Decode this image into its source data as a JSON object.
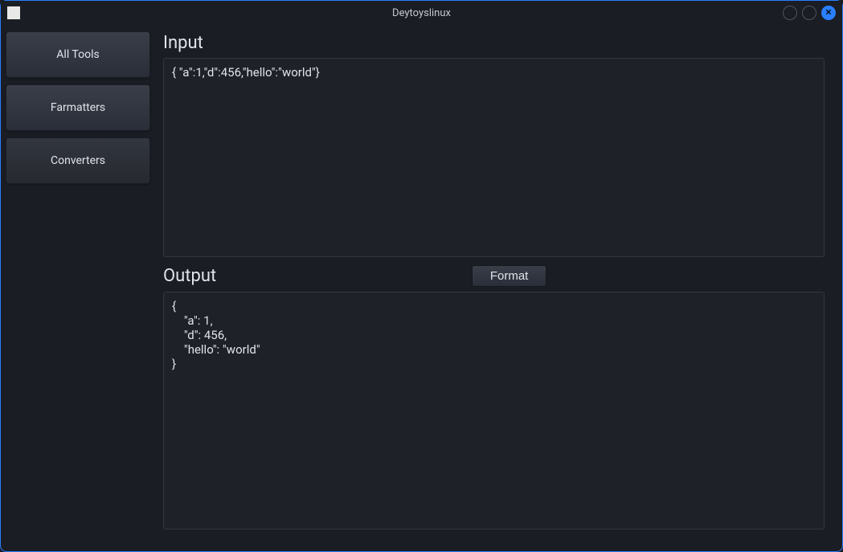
{
  "window": {
    "title": "Deytoyslinux"
  },
  "sidebar": {
    "items": [
      {
        "label": "All Tools"
      },
      {
        "label": "Farmatters"
      },
      {
        "label": "Converters"
      }
    ]
  },
  "main": {
    "input_label": "Input",
    "input_value": "{ \"a\":1,\"d\":456,\"hello\":\"world\"}",
    "output_label": "Output",
    "format_label": "Format",
    "output_value": "{\n    \"a\": 1,\n    \"d\": 456,\n    \"hello\": \"world\"\n}"
  }
}
